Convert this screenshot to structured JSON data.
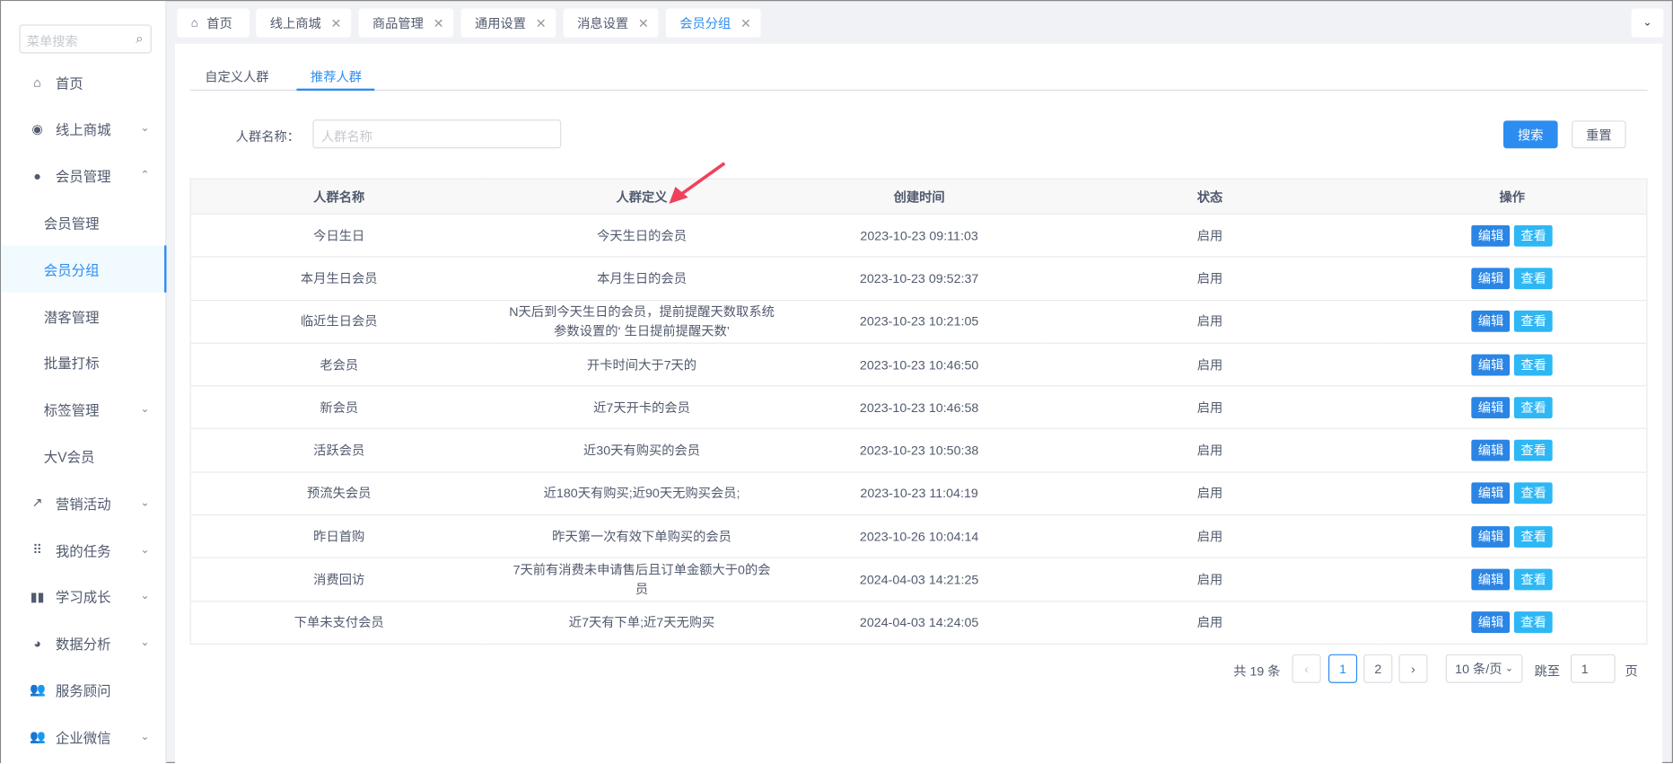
{
  "sidebar": {
    "search_placeholder": "菜单搜索",
    "items": [
      {
        "label": "首页",
        "icon": "home-icon"
      },
      {
        "label": "线上商城",
        "icon": "shop-icon"
      },
      {
        "label": "会员管理",
        "icon": "user-icon"
      },
      {
        "label": "会员管理"
      },
      {
        "label": "会员分组"
      },
      {
        "label": "潜客管理"
      },
      {
        "label": "批量打标"
      },
      {
        "label": "标签管理"
      },
      {
        "label": "大V会员"
      },
      {
        "label": "营销活动",
        "icon": "trend-icon"
      },
      {
        "label": "我的任务",
        "icon": "grid-icon"
      },
      {
        "label": "学习成长",
        "icon": "book-icon"
      },
      {
        "label": "数据分析",
        "icon": "pie-icon"
      },
      {
        "label": "服务顾问",
        "icon": "people-icon"
      },
      {
        "label": "企业微信",
        "icon": "people-icon"
      }
    ]
  },
  "tabs": [
    "首页",
    "线上商城",
    "商品管理",
    "通用设置",
    "消息设置",
    "会员分组"
  ],
  "inner_tabs": [
    "自定义人群",
    "推荐人群"
  ],
  "filter": {
    "label": "人群名称：",
    "placeholder": "人群名称",
    "search": "搜索",
    "reset": "重置"
  },
  "table": {
    "headers": [
      "人群名称",
      "人群定义",
      "创建时间",
      "状态",
      "操作"
    ],
    "edit": "编辑",
    "view": "查看",
    "rows": [
      [
        "今日生日",
        "今天生日的会员",
        "2023-10-23 09:11:03",
        "启用"
      ],
      [
        "本月生日会员",
        "本月生日的会员",
        "2023-10-23 09:52:37",
        "启用"
      ],
      [
        "临近生日会员",
        "N天后到今天生日的会员，提前提醒天数取系统参数设置的‘ 生日提前提醒天数’",
        "2023-10-23 10:21:05",
        "启用"
      ],
      [
        "老会员",
        "开卡时间大于7天的",
        "2023-10-23 10:46:50",
        "启用"
      ],
      [
        "新会员",
        "近7天开卡的会员",
        "2023-10-23 10:46:58",
        "启用"
      ],
      [
        "活跃会员",
        "近30天有购买的会员",
        "2023-10-23 10:50:38",
        "启用"
      ],
      [
        "预流失会员",
        "近180天有购买;近90天无购买会员;",
        "2023-10-23 11:04:19",
        "启用"
      ],
      [
        "昨日首购",
        "昨天第一次有效下单购买的会员",
        "2023-10-26 10:04:14",
        "启用"
      ],
      [
        "消费回访",
        "7天前有消费未申请售后且订单金额大于0的会员",
        "2024-04-03 14:21:25",
        "启用"
      ],
      [
        "下单未支付会员",
        "近7天有下单;近7天无购买",
        "2024-04-03 14:24:05",
        "启用"
      ]
    ]
  },
  "pagination": {
    "total": "共 19 条",
    "pages": [
      "1",
      "2"
    ],
    "page_size": "10 条/页",
    "goto": "跳至",
    "goto_value": "1",
    "page_unit": "页"
  },
  "colors": {
    "primary": "#2d8cf0",
    "info": "#2db7f5",
    "arrow": "#f0415b"
  }
}
